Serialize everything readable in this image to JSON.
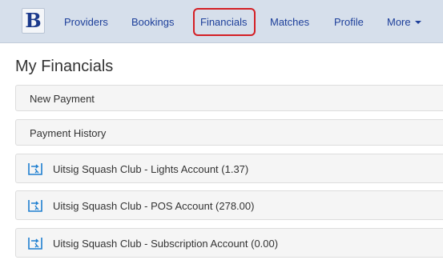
{
  "brand": {
    "letter": "B"
  },
  "nav": {
    "providers": "Providers",
    "bookings": "Bookings",
    "financials": "Financials",
    "matches": "Matches",
    "profile": "Profile",
    "more": "More"
  },
  "page": {
    "title": "My Financials"
  },
  "panels": {
    "new_payment": "New Payment",
    "payment_history": "Payment History"
  },
  "accounts": [
    {
      "label": "Uitsig Squash Club - Lights Account (1.37)",
      "icon": "account-transfer-icon"
    },
    {
      "label": "Uitsig Squash Club - POS Account (278.00)",
      "icon": "account-transfer-icon"
    },
    {
      "label": "Uitsig Squash Club - Subscription Account (0.00)",
      "icon": "account-transfer-icon"
    }
  ],
  "colors": {
    "navbar": "#d6dfeb",
    "link": "#1d3f9a",
    "highlight": "#d41f25",
    "icon": "#1e7fd0"
  }
}
